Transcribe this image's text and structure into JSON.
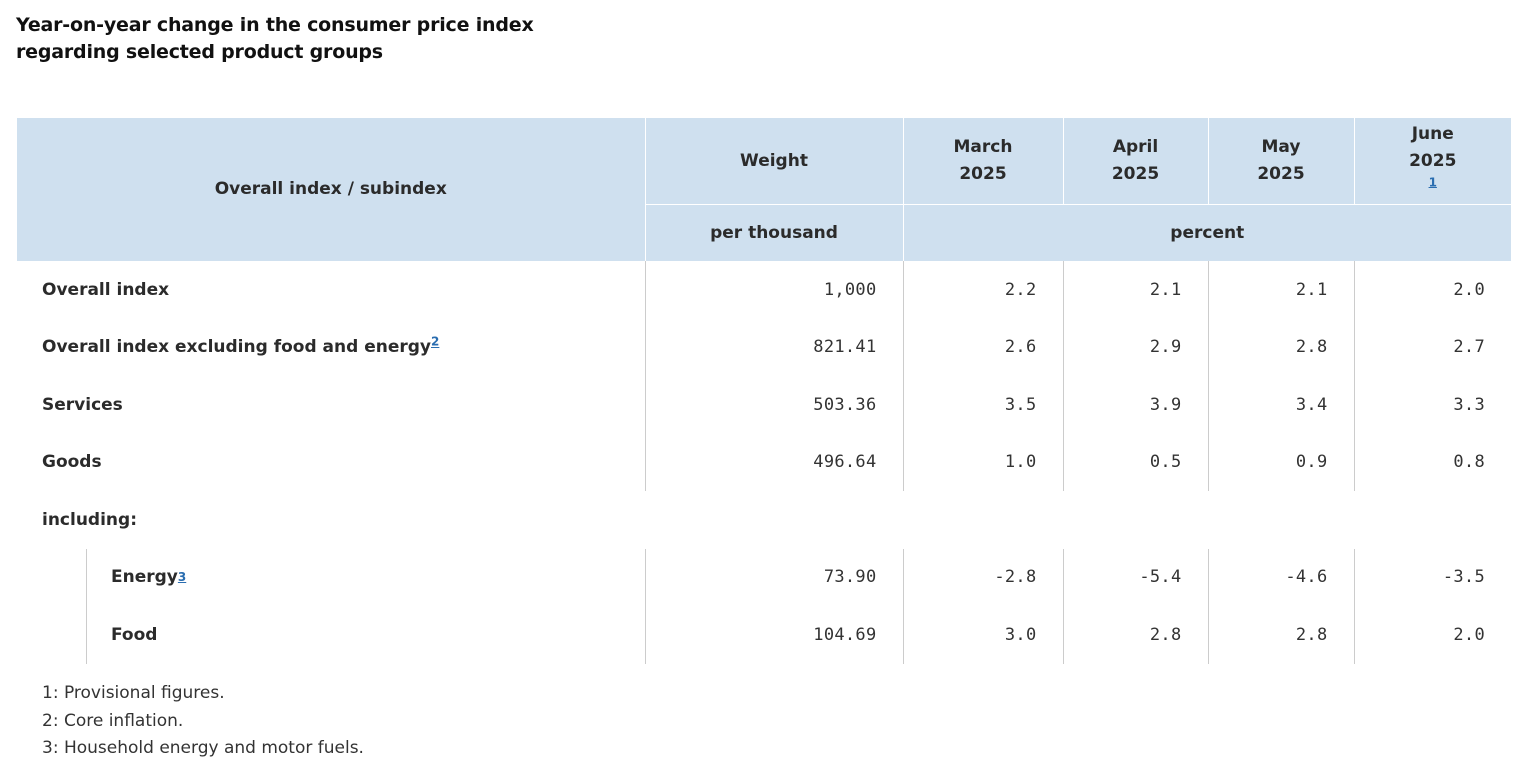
{
  "title": {
    "line1": "Year-on-year change in the consumer price index",
    "line2": "regarding selected product groups"
  },
  "header": {
    "row_label": "Overall index / subindex",
    "weight": "Weight",
    "weight_unit": "per thousand",
    "percent_unit": "percent",
    "months": [
      {
        "month": "March",
        "year": "2025",
        "footnote": ""
      },
      {
        "month": "April",
        "year": "2025",
        "footnote": ""
      },
      {
        "month": "May",
        "year": "2025",
        "footnote": ""
      },
      {
        "month": "June",
        "year": "2025",
        "footnote": "1"
      }
    ]
  },
  "rows": [
    {
      "label": "Overall index",
      "footnote": "",
      "weight": "1,000",
      "values": [
        "2.2",
        "2.1",
        "2.1",
        "2.0"
      ]
    },
    {
      "label": "Overall index excluding food and energy",
      "footnote": "2",
      "weight": "821.41",
      "values": [
        "2.6",
        "2.9",
        "2.8",
        "2.7"
      ]
    },
    {
      "label": "Services",
      "footnote": "",
      "weight": "503.36",
      "values": [
        "3.5",
        "3.9",
        "3.4",
        "3.3"
      ]
    },
    {
      "label": "Goods",
      "footnote": "",
      "weight": "496.64",
      "values": [
        "1.0",
        "0.5",
        "0.9",
        "0.8"
      ]
    }
  ],
  "including_label": "including:",
  "subrows": [
    {
      "label": "Energy",
      "footnote": "3",
      "weight": "73.90",
      "values": [
        "-2.8",
        "-5.4",
        "-4.6",
        "-3.5"
      ]
    },
    {
      "label": "Food",
      "footnote": "",
      "weight": "104.69",
      "values": [
        "3.0",
        "2.8",
        "2.8",
        "2.0"
      ]
    }
  ],
  "notes": [
    "1: Provisional figures.",
    "2: Core inflation.",
    "3: Household energy and motor fuels."
  ],
  "colors": {
    "header_bg": "#cfe0ef",
    "footnote_link": "#2a6db0",
    "divider": "#cccccc"
  }
}
